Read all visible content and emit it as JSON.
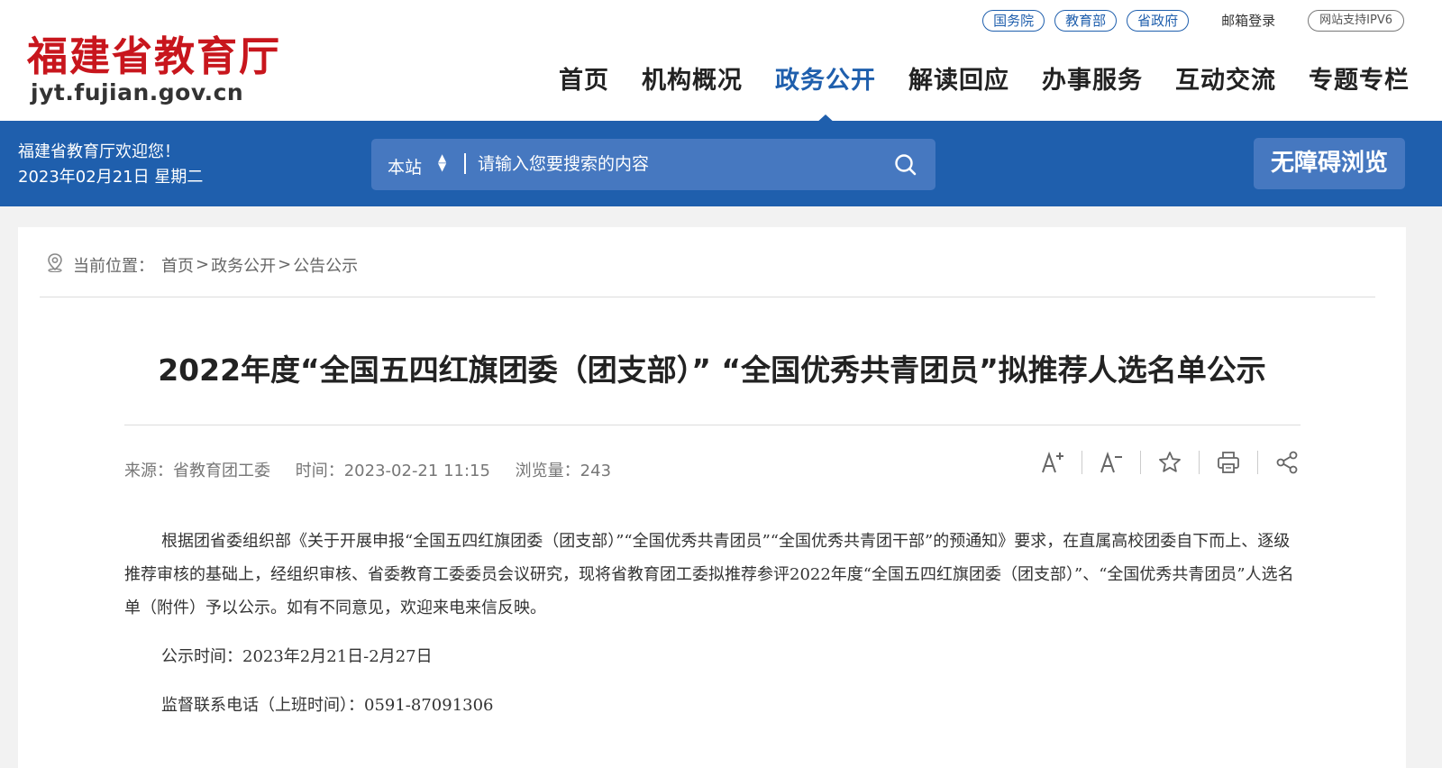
{
  "site": {
    "name_cn": "福建省教育厅",
    "domain": "jyt.fujian.gov.cn"
  },
  "toplinks": {
    "pills": [
      "国务院",
      "教育部",
      "省政府"
    ],
    "mail": "邮箱登录",
    "ipv6": "网站支持IPV6"
  },
  "nav": {
    "items": [
      "首页",
      "机构概况",
      "政务公开",
      "解读回应",
      "办事服务",
      "互动交流",
      "专题专栏"
    ],
    "active": "政务公开"
  },
  "bar": {
    "welcome": "福建省教育厅欢迎您！",
    "date": "2023年02月21日 星期二",
    "search_scope": "本站",
    "search_placeholder": "请输入您要搜索的内容",
    "accessibility": "无障碍浏览"
  },
  "breadcrumb": {
    "label": "当前位置：",
    "items": [
      "首页",
      "政务公开",
      "公告公示"
    ],
    "separator": ">"
  },
  "article": {
    "title": "2022年度“全国五四红旗团委（团支部）” “全国优秀共青团员”拟推荐人选名单公示",
    "source": "来源：省教育团工委",
    "time": "时间：2023-02-21 11:15",
    "views": "浏览量：243",
    "paragraphs": [
      "根据团省委组织部《关于开展申报“全国五四红旗团委（团支部）”“全国优秀共青团员”“全国优秀共青团干部”的预通知》要求，在直属高校团委自下而上、逐级推荐审核的基础上，经组织审核、省委教育工委委员会议研究，现将省教育团工委拟推荐参评2022年度“全国五四红旗团委（团支部）”、“全国优秀共青团员”人选名单（附件）予以公示。如有不同意见，欢迎来电来信反映。",
      "公示时间：2023年2月21日-2月27日",
      "监督联系电话（上班时间）：0591-87091306"
    ]
  },
  "tools": [
    "font-increase-icon",
    "font-decrease-icon",
    "star-icon",
    "print-icon",
    "share-icon"
  ],
  "colors": {
    "brand_red": "#c8161d",
    "primary_blue": "#1f5fad",
    "search_blue": "#4678c0",
    "page_bg": "#f2f2f2"
  }
}
